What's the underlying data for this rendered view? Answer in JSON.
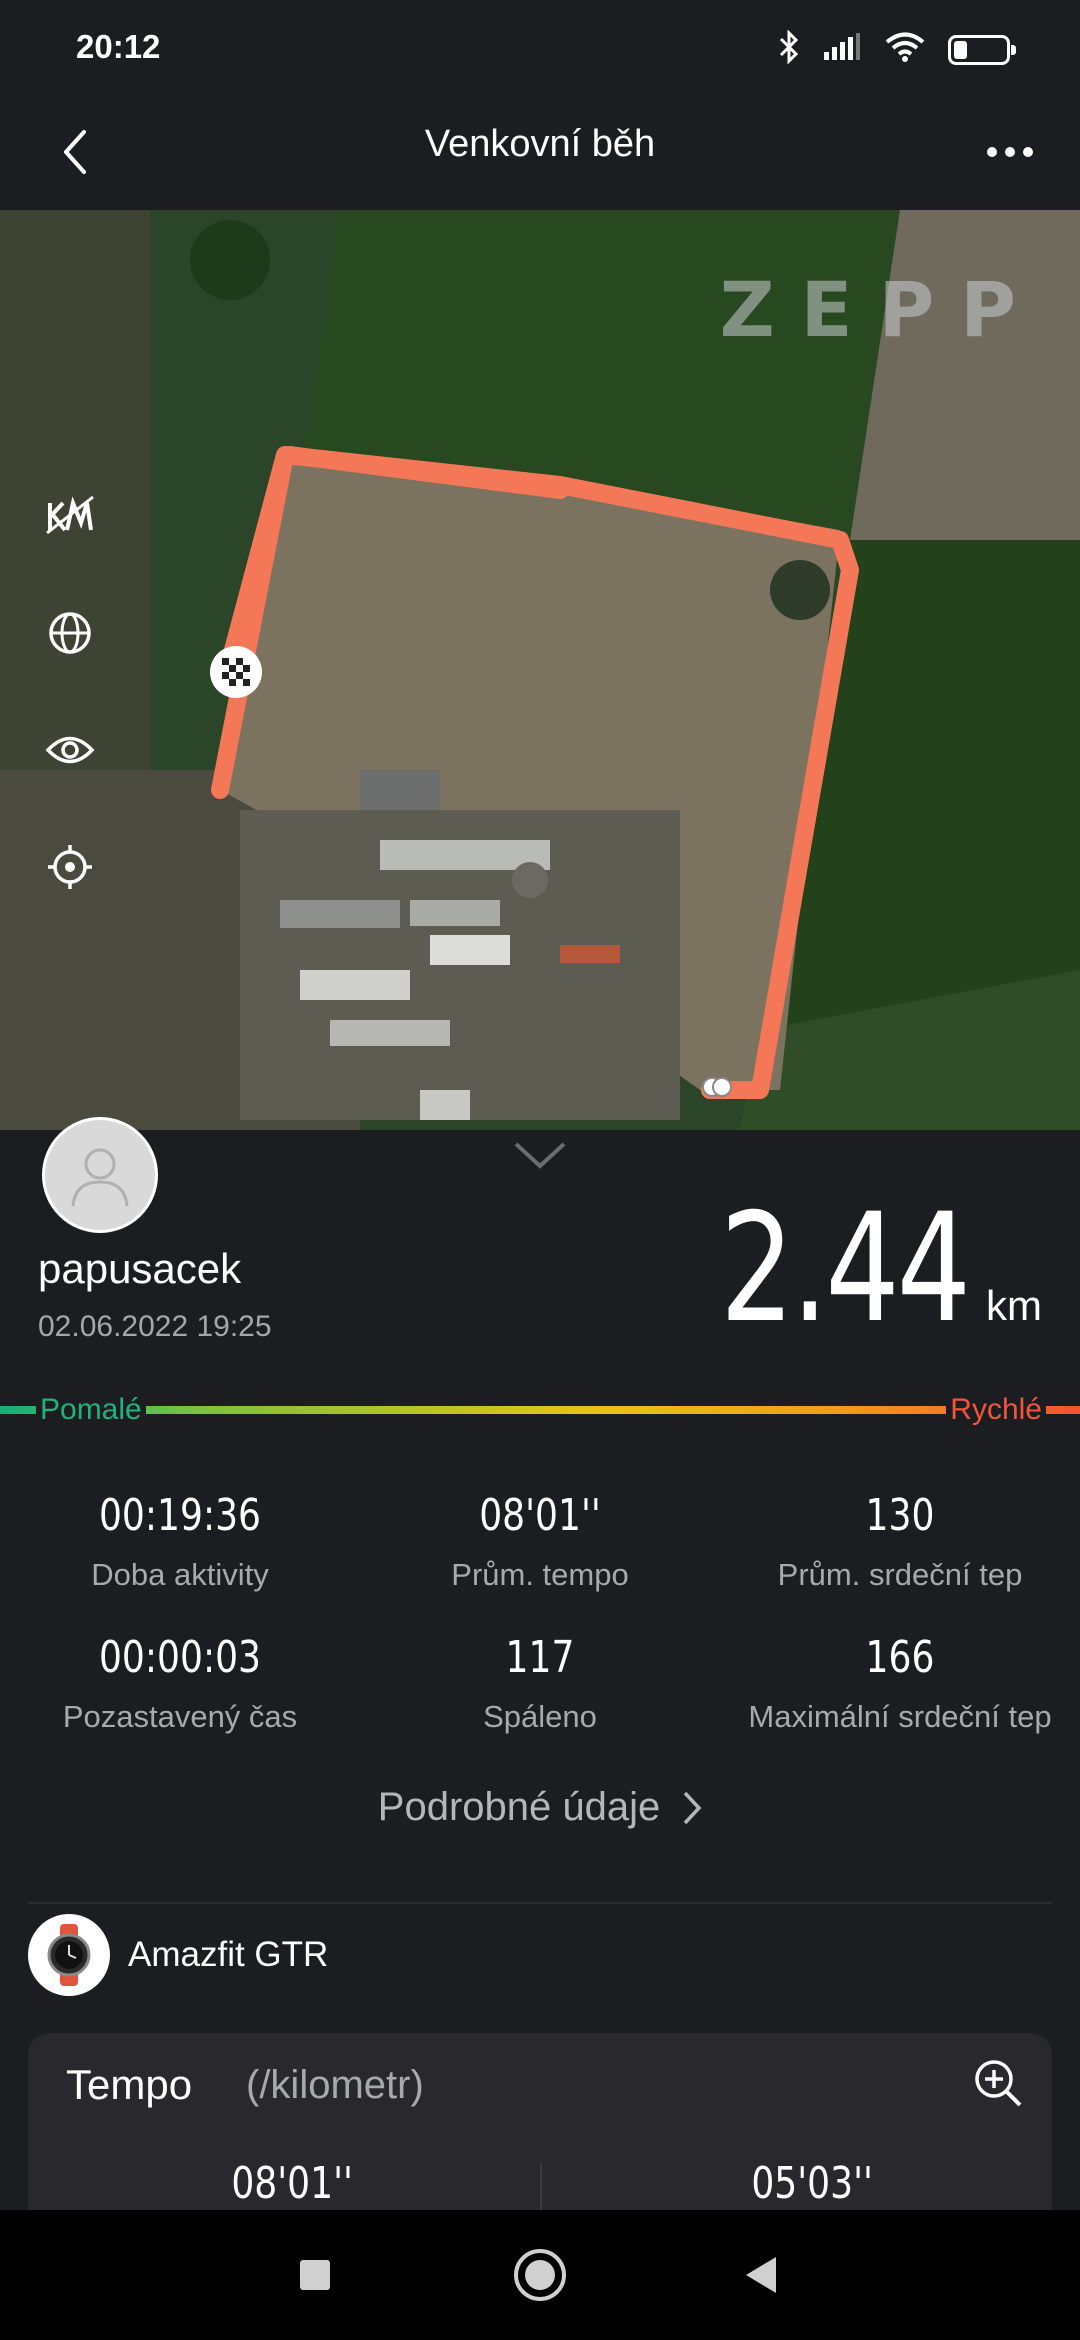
{
  "status_bar": {
    "time": "20:12",
    "battery": "25",
    "battery_level": 0.25
  },
  "header": {
    "title": "Venkovní běh"
  },
  "map": {
    "logo": "ZEPP",
    "tools": [
      "km-icon",
      "globe-icon",
      "eye-icon",
      "locate-icon"
    ]
  },
  "summary": {
    "username": "papusacek",
    "datetime": "02.06.2022 19:25",
    "distance": "2.44",
    "unit": "km"
  },
  "pace_scale": {
    "slow": "Pomalé",
    "fast": "Rychlé"
  },
  "stats": [
    {
      "value": "00:19:36",
      "label": "Doba aktivity"
    },
    {
      "value": "08'01''",
      "label": "Prům. tempo"
    },
    {
      "value": "130",
      "label": "Prům. srdeční tep"
    },
    {
      "value": "00:00:03",
      "label": "Pozastavený čas"
    },
    {
      "value": "117",
      "label": "Spáleno"
    },
    {
      "value": "166",
      "label": "Maximální srdeční tep"
    }
  ],
  "details_link": "Podrobné údaje",
  "device": {
    "name": "Amazfit GTR"
  },
  "tempo_card": {
    "title": "Tempo",
    "subtitle": "(/kilometr)",
    "values": [
      "08'01''",
      "05'03''"
    ]
  },
  "colors": {
    "route": "#f47857",
    "slow": "#20b27b",
    "fast": "#f2553a"
  }
}
